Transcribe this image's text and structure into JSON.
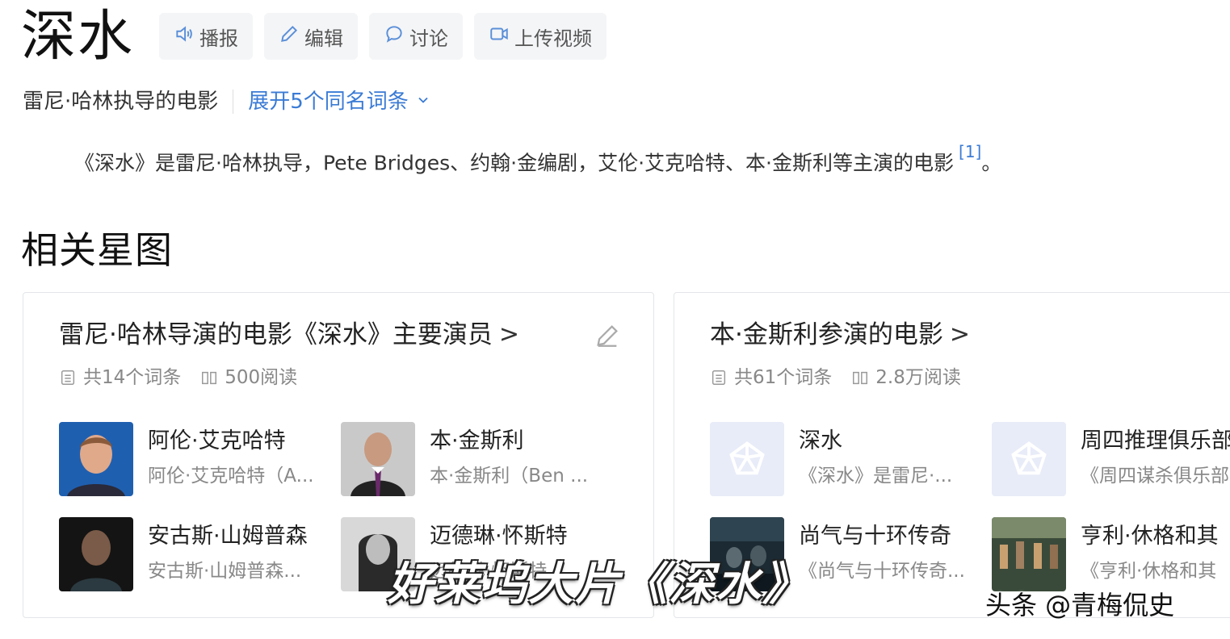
{
  "page": {
    "title": "深水",
    "actions": [
      {
        "label": "播报",
        "icon": "speaker-icon"
      },
      {
        "label": "编辑",
        "icon": "pencil-icon"
      },
      {
        "label": "讨论",
        "icon": "chat-bubble-icon"
      },
      {
        "label": "上传视频",
        "icon": "video-camera-icon"
      }
    ],
    "subtitle": "雷尼·哈林执导的电影",
    "expand_label": "展开5个同名词条",
    "summary": "《深水》是雷尼·哈林执导，Pete Bridges、约翰·金编剧，艾伦·艾克哈特、本·金斯利等主演的电影",
    "summary_ref": "[1]",
    "summary_end": "。"
  },
  "section": {
    "title": "相关星图"
  },
  "cards": [
    {
      "title": "雷尼·哈林导演的电影《深水》主要演员",
      "chevron": ">",
      "entries": "共14个词条",
      "reads": "500阅读",
      "items": [
        {
          "name": "阿伦·艾克哈特",
          "sub": "阿伦·艾克哈特（A..."
        },
        {
          "name": "本·金斯利",
          "sub": "本·金斯利（Ben ..."
        },
        {
          "name": "安古斯·山姆普森",
          "sub": "安古斯·山姆普森..."
        },
        {
          "name": "迈德琳·怀斯特",
          "sub": "迈德琳·怀斯特..."
        }
      ]
    },
    {
      "title": "本·金斯利参演的电影",
      "chevron": ">",
      "entries": "共61个词条",
      "reads": "2.8万阅读",
      "items": [
        {
          "name": "深水",
          "sub": "《深水》是雷尼·..."
        },
        {
          "name": "周四推理俱乐部",
          "sub": "《周四谋杀俱乐部"
        },
        {
          "name": "尚气与十环传奇",
          "sub": "《尚气与十环传奇..."
        },
        {
          "name": "亨利·休格和其",
          "sub": "《亨利·休格和其"
        }
      ]
    }
  ],
  "overlay": {
    "caption": "好莱坞大片《深水》",
    "watermark": "头条 @青梅侃史"
  },
  "colors": {
    "accent": "#3a7bd5",
    "placeholder_bg": "#e8ecf8"
  }
}
